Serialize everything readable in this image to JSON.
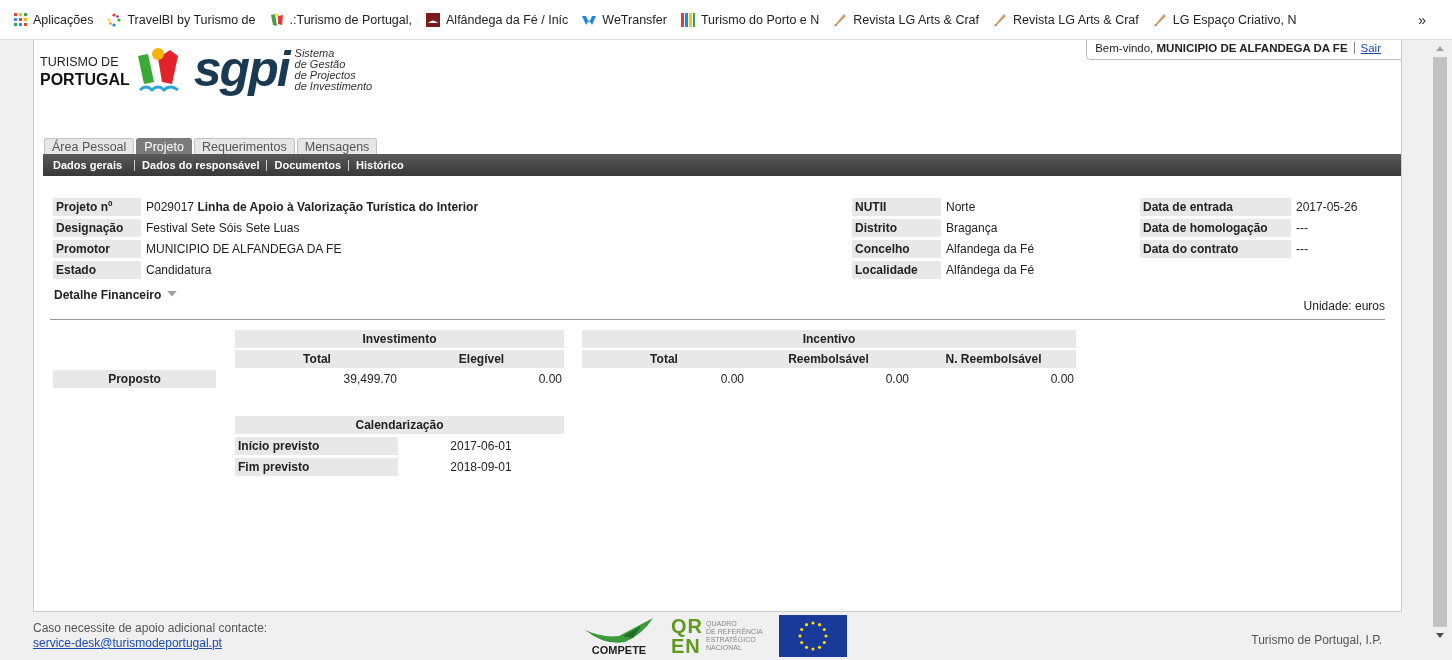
{
  "bookmarks": {
    "apps": "Aplicações",
    "items": [
      {
        "label": "TravelBI by Turismo de"
      },
      {
        "label": ".:Turismo de Portugal,"
      },
      {
        "label": "Alfândega da Fé / Iníc"
      },
      {
        "label": "WeTransfer"
      },
      {
        "label": "Turismo do Porto e N"
      },
      {
        "label": "Revista LG Arts & Craf"
      },
      {
        "label": "Revista LG Arts & Craf"
      },
      {
        "label": "LG Espaço Criativo, N"
      }
    ],
    "more": "»"
  },
  "header": {
    "brand_line1": "TURISMO DE",
    "brand_line2": "PORTUGAL",
    "product": "sgpi",
    "tagline": [
      "Sistema",
      "de Gestão",
      "de Projectos",
      "de Investimento"
    ]
  },
  "user_box": {
    "welcome": "Bem-vindo, **MUNICIPIO DE ALFANDEGA DA FE**",
    "logout": "Sair"
  },
  "tabs": [
    {
      "label": "Área Pessoal",
      "selected": false
    },
    {
      "label": "Projeto",
      "selected": true
    },
    {
      "label": "Requerimentos",
      "selected": false
    },
    {
      "label": "Mensagens",
      "selected": false
    }
  ],
  "subnav": [
    {
      "label": "Dados gerais"
    },
    {
      "label": "Dados do responsável"
    },
    {
      "label": "Documentos"
    },
    {
      "label": "Histórico"
    }
  ],
  "info_columns": [
    [
      {
        "label": "Projeto nº",
        "value": "P029017 **Linha de Apoio à Valorização Turística do Interior**"
      },
      {
        "label": "Designação",
        "value": "Festival Sete Sóis Sete Luas"
      },
      {
        "label": "Promotor",
        "value": "MUNICIPIO DE ALFANDEGA DA FE"
      },
      {
        "label": "Estado",
        "value": "Candidatura"
      }
    ],
    [
      {
        "label": "NUTII",
        "value": "Norte"
      },
      {
        "label": "Distrito",
        "value": "Bragança"
      },
      {
        "label": "Concelho",
        "value": "Alfandega da Fé"
      },
      {
        "label": "Localidade",
        "value": "Alfândega da Fé"
      }
    ],
    [
      {
        "label": "Data de entrada",
        "value": "2017-05-26"
      },
      {
        "label": "Data de homologação",
        "value": "---"
      },
      {
        "label": "Data do contrato",
        "value": "---"
      }
    ]
  ],
  "financial": {
    "toggle": "Detalhe Financeiro",
    "expanded": true,
    "unit": "Unidade: euros",
    "groups": [
      {
        "title": "Investimento",
        "columns": [
          "Total",
          "Elegível"
        ]
      },
      {
        "title": "Incentivo",
        "columns": [
          "Total",
          "Reembolsável",
          "N. Reembolsável"
        ]
      }
    ],
    "rows": [
      {
        "label": "Proposto",
        "values": [
          "39,499.70",
          "0.00",
          "0.00",
          "0.00",
          "0.00"
        ]
      }
    ]
  },
  "schedule": {
    "title": "Calendarização",
    "rows": [
      {
        "label": "Início previsto",
        "value": "2017-06-01"
      },
      {
        "label": "Fim previsto",
        "value": "2018-09-01"
      }
    ]
  },
  "footer": {
    "help_text": "Caso necessite de apoio adicional contacte:",
    "email": "service-desk@turismodeportugal.pt",
    "compete": "COMPETE",
    "qren_mark": [
      "QR",
      "EN"
    ],
    "qren_text": [
      "QUADRO",
      "DE REFERÊNCIA",
      "ESTRATÉGICO",
      "NACIONAL"
    ],
    "copyright": "Turismo de Portugal, I.P."
  }
}
